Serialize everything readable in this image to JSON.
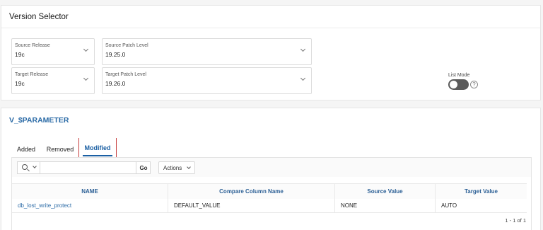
{
  "version_selector": {
    "title": "Version Selector",
    "source_release": {
      "label": "Source Release",
      "value": "19c"
    },
    "source_patch": {
      "label": "Source Patch Level",
      "value": "19.25.0"
    },
    "target_release": {
      "label": "Target Release",
      "value": "19c"
    },
    "target_patch": {
      "label": "Target Patch Level",
      "value": "19.26.0"
    },
    "list_mode": {
      "label": "List Mode",
      "enabled": false,
      "help": "?"
    }
  },
  "parameter_region": {
    "title": "V_$PARAMETER",
    "tabs": [
      {
        "label": "Added",
        "selected": false
      },
      {
        "label": "Removed",
        "selected": false
      },
      {
        "label": "Modified",
        "selected": true
      }
    ],
    "toolbar": {
      "search_placeholder": "",
      "go_label": "Go",
      "actions_label": "Actions"
    },
    "columns": [
      "NAME",
      "Compare Column Name",
      "Source Value",
      "Target Value"
    ],
    "rows": [
      {
        "name": "db_lost_write_protect",
        "compare_column": "DEFAULT_VALUE",
        "source_value": "NONE",
        "target_value": "AUTO"
      }
    ],
    "pagination": "1 - 1 of 1"
  },
  "colors": {
    "link": "#2a6aa6",
    "tab_active": "#1a5fa3",
    "tab_focus_border": "#c73d3d"
  }
}
